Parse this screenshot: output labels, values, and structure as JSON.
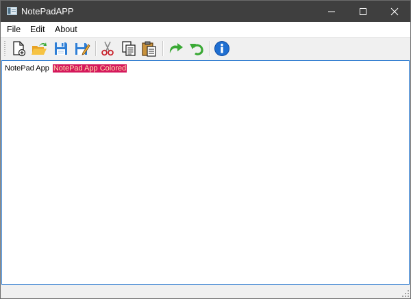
{
  "window": {
    "title": "NotePadAPP"
  },
  "menubar": {
    "items": [
      {
        "label": "File"
      },
      {
        "label": "Edit"
      },
      {
        "label": "About"
      }
    ]
  },
  "toolbar": {
    "buttons": [
      {
        "icon": "new-document-icon"
      },
      {
        "icon": "open-folder-icon"
      },
      {
        "icon": "save-icon"
      },
      {
        "icon": "save-as-icon"
      },
      {
        "icon": "cut-icon"
      },
      {
        "icon": "copy-icon"
      },
      {
        "icon": "paste-icon"
      },
      {
        "icon": "redo-icon"
      },
      {
        "icon": "undo-icon"
      },
      {
        "icon": "info-icon"
      }
    ]
  },
  "editor": {
    "plain_text": "NotePad App",
    "colored_text": "NotePad App Colored",
    "colored_background": "#d5185c",
    "colored_foreground": "#ffe8b0"
  },
  "colors": {
    "titlebar": "#3f3f3f",
    "accent_border": "#2b7ad0"
  }
}
